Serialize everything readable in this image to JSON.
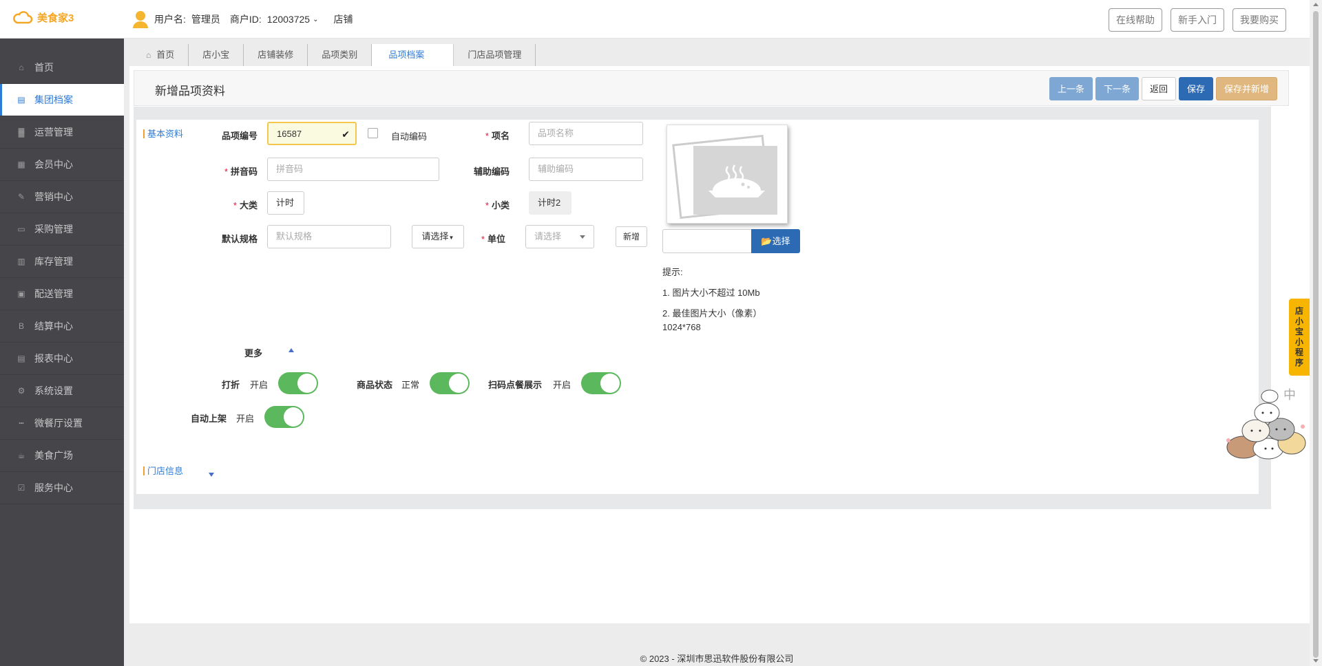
{
  "header": {
    "logo_text": "美食家3",
    "username_label": "用户名:",
    "username": "管理员",
    "merchant_label": "商户ID:",
    "merchant_id": "12003725",
    "shop_link": "店铺",
    "buttons": [
      "在线帮助",
      "新手入门",
      "我要购买"
    ]
  },
  "sidebar": {
    "items": [
      {
        "label": "首页",
        "icon": "home-icon"
      },
      {
        "label": "集团档案",
        "icon": "file-icon"
      },
      {
        "label": "运营管理",
        "icon": "bar-chart-icon"
      },
      {
        "label": "会员中心",
        "icon": "id-card-icon"
      },
      {
        "label": "营销中心",
        "icon": "edit-icon"
      },
      {
        "label": "采购管理",
        "icon": "book-icon"
      },
      {
        "label": "库存管理",
        "icon": "building-icon"
      },
      {
        "label": "配送管理",
        "icon": "truck-icon"
      },
      {
        "label": "结算中心",
        "icon": "bitcoin-icon"
      },
      {
        "label": "报表中心",
        "icon": "document-icon"
      },
      {
        "label": "系统设置",
        "icon": "gears-icon"
      },
      {
        "label": "微餐厅设置",
        "icon": "cutlery-icon"
      },
      {
        "label": "美食广场",
        "icon": "coffee-icon"
      },
      {
        "label": "服务中心",
        "icon": "check-square-icon"
      }
    ],
    "active_index": 1
  },
  "tabs": [
    "首页",
    "店小宝",
    "店铺装修",
    "品项类别",
    "品项档案",
    "门店品项管理"
  ],
  "active_tab": 4,
  "page": {
    "title": "新增品项资料",
    "buttons": {
      "prev": "上一条",
      "next": "下一条",
      "back": "返回",
      "save": "保存",
      "save_new": "保存并新增"
    }
  },
  "form": {
    "section_basic": "基本资料",
    "section_store": "门店信息",
    "code_label": "品项编号",
    "code_value": "16587",
    "auto_code_label": "自动编码",
    "name_label": "项名",
    "name_placeholder": "品项名称",
    "pinyin_label": "拼音码",
    "pinyin_placeholder": "拼音码",
    "aux_code_label": "辅助编码",
    "aux_code_placeholder": "辅助编码",
    "category_label": "大类",
    "category_value": "计时",
    "subcategory_label": "小类",
    "subcategory_value": "计时2",
    "spec_label": "默认规格",
    "spec_placeholder": "默认规格",
    "spec_select": "请选择",
    "unit_label": "单位",
    "unit_placeholder": "请选择",
    "unit_new": "新增",
    "more_label": "更多",
    "toggles": [
      {
        "label": "打折",
        "value": "开启"
      },
      {
        "label": "商品状态",
        "value": "正常"
      },
      {
        "label": "扫码点餐展示",
        "value": "开启"
      },
      {
        "label": "自动上架",
        "value": "开启"
      }
    ]
  },
  "image_upload": {
    "select_label": "选择",
    "tips_title": "提示:",
    "tip1": "1. 图片大小不超过 10Mb",
    "tip2": "2. 最佳图片大小（像素）",
    "tip3": "1024*768"
  },
  "float_tab_chars": [
    "店",
    "小",
    "宝",
    "小",
    "程",
    "序"
  ],
  "mascot_char": "中",
  "footer": "© 2023 - 深圳市思迅软件股份有限公司",
  "colors": {
    "sidebar_bg": "#45454a",
    "accent_blue": "#2e7cd6",
    "primary_button": "#2d6ab4",
    "orange_button": "#e0b77e",
    "toggle_on": "#5cb85c",
    "brand_orange": "#f5a623"
  }
}
